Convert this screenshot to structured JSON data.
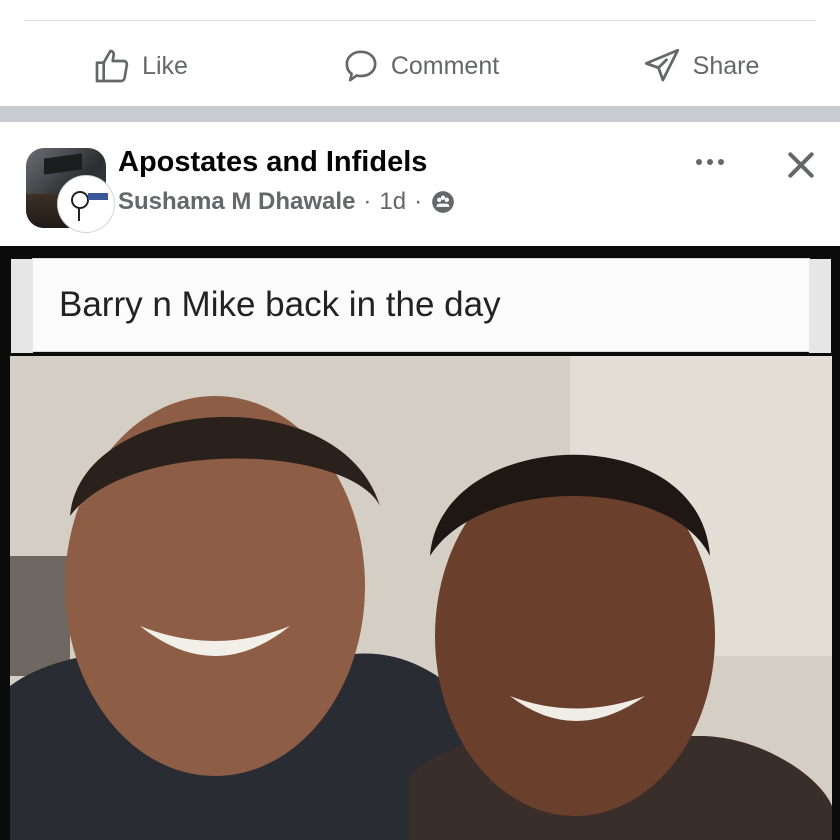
{
  "actions": {
    "like_label": "Like",
    "comment_label": "Comment",
    "share_label": "Share"
  },
  "post": {
    "group_name": "Apostates and Infidels",
    "author": "Sushama M Dhawale",
    "separator": "·",
    "time": "1d",
    "privacy_icon": "group-audience-icon"
  },
  "media": {
    "caption": "Barry n Mike back in the day"
  },
  "colors": {
    "text_primary": "#050505",
    "text_secondary": "#65676b",
    "separator": "#c9ccd1"
  }
}
